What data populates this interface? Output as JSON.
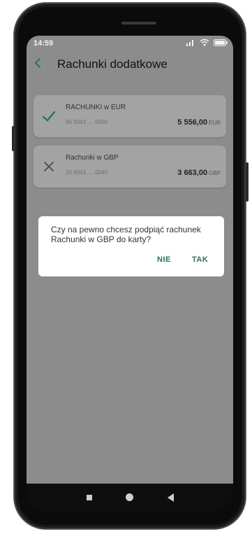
{
  "status_bar": {
    "time": "14:59"
  },
  "app_bar": {
    "title": "Rachunki dodatkowe"
  },
  "accounts": [
    {
      "name": "RACHUNKI w EUR",
      "number": "86 9043 .... 0000",
      "amount": "5 556,00",
      "currency": "EUR",
      "selected": true,
      "icon": "check-icon"
    },
    {
      "name": "Rachunki w GBP",
      "number": "10 9043 .... 0040",
      "amount": "3 663,00",
      "currency": "GBP",
      "selected": false,
      "icon": "close-icon"
    }
  ],
  "dialog": {
    "message": "Czy na pewno chcesz podpiąć rachunek Rachunki w GBP do karty?",
    "cancel_label": "NIE",
    "confirm_label": "TAK"
  },
  "colors": {
    "accent": "#1e7a52",
    "overlay": "#8c8c8c",
    "card": "#a3a3a3"
  }
}
